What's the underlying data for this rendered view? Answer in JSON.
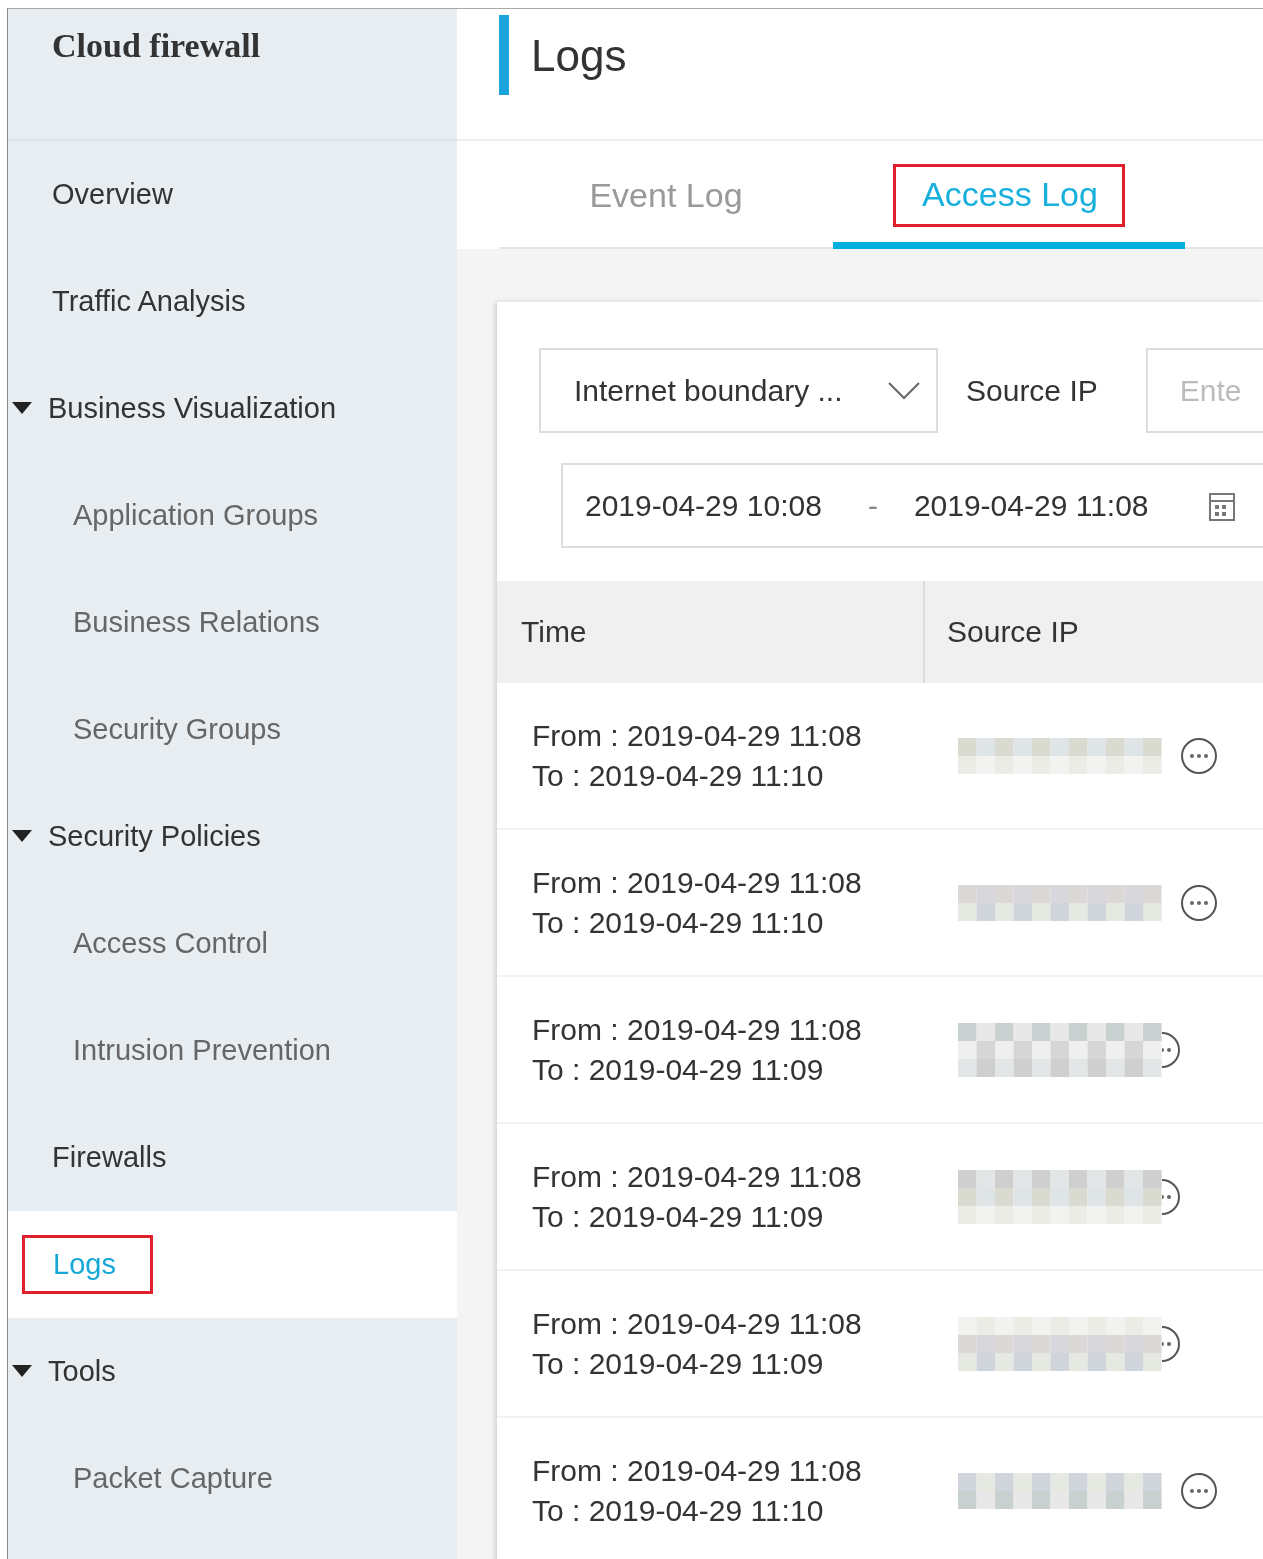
{
  "sidebar": {
    "title": "Cloud firewall",
    "items": [
      {
        "label": "Overview",
        "kind": "link",
        "selected": false,
        "highlighted": false
      },
      {
        "label": "Traffic Analysis",
        "kind": "link",
        "selected": false,
        "highlighted": false
      },
      {
        "label": "Business Visualization",
        "kind": "group",
        "expanded": true,
        "children": [
          {
            "label": "Application Groups",
            "kind": "child",
            "selected": false,
            "highlighted": false
          },
          {
            "label": "Business Relations",
            "kind": "child",
            "selected": false,
            "highlighted": false
          },
          {
            "label": "Security Groups",
            "kind": "child",
            "selected": false,
            "highlighted": false
          }
        ]
      },
      {
        "label": "Security Policies",
        "kind": "group",
        "expanded": true,
        "children": [
          {
            "label": "Access Control",
            "kind": "child",
            "selected": false,
            "highlighted": false
          },
          {
            "label": "Intrusion Prevention",
            "kind": "child",
            "selected": false,
            "highlighted": false
          }
        ]
      },
      {
        "label": "Firewalls",
        "kind": "link",
        "selected": false,
        "highlighted": false
      },
      {
        "label": "Logs",
        "kind": "link",
        "selected": true,
        "highlighted": true
      },
      {
        "label": "Tools",
        "kind": "group",
        "expanded": true,
        "children": [
          {
            "label": "Packet Capture",
            "kind": "child",
            "selected": false,
            "highlighted": false
          }
        ]
      }
    ]
  },
  "page_title": "Logs",
  "tabs": [
    {
      "label": "Event Log",
      "selected": false,
      "highlighted": false
    },
    {
      "label": "Access Log",
      "selected": true,
      "highlighted": true
    }
  ],
  "filters": {
    "boundary_select": {
      "value": "Internet boundary ..."
    },
    "source_ip_label": "Source IP",
    "source_ip_field": {
      "placeholder": "Ente"
    },
    "date_range": {
      "start": "2019-04-29 10:08",
      "separator": "-",
      "end": "2019-04-29 11:08"
    }
  },
  "table": {
    "columns": [
      "Time",
      "Source IP"
    ],
    "rows": [
      {
        "from": "From : 2019-04-29 11:08",
        "to": "To : 2019-04-29 11:10",
        "icon_covered": false
      },
      {
        "from": "From : 2019-04-29 11:08",
        "to": "To : 2019-04-29 11:10",
        "icon_covered": false
      },
      {
        "from": "From : 2019-04-29 11:08",
        "to": "To : 2019-04-29 11:09",
        "icon_covered": true
      },
      {
        "from": "From : 2019-04-29 11:08",
        "to": "To : 2019-04-29 11:09",
        "icon_covered": true
      },
      {
        "from": "From : 2019-04-29 11:08",
        "to": "To : 2019-04-29 11:09",
        "icon_covered": true
      },
      {
        "from": "From : 2019-04-29 11:08",
        "to": "To : 2019-04-29 11:10",
        "icon_covered": false
      }
    ]
  }
}
